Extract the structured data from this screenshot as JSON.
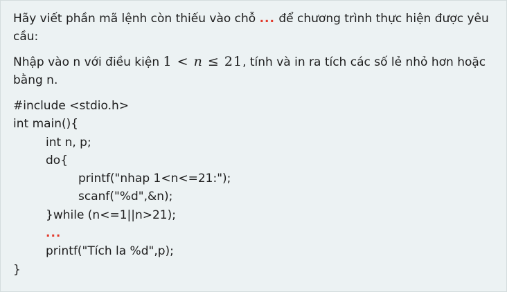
{
  "intro": {
    "before_marker": "Hãy viết phần mã lệnh còn thiếu vào chỗ ",
    "marker": "...",
    "after_marker": " để chương trình thực hiện được yêu cầu:"
  },
  "task": {
    "before_math": "Nhập vào n với điều kiện ",
    "math": {
      "lower": "1",
      "lt": "<",
      "var": "n",
      "le": "≤",
      "upper": "21"
    },
    "after_math": ", tính và in ra tích các số lẻ nhỏ hơn hoặc bằng n."
  },
  "code_lines": [
    {
      "indent": 0,
      "text": "#include <stdio.h>"
    },
    {
      "indent": 0,
      "text": "int main(){"
    },
    {
      "indent": 1,
      "text": "int n, p;"
    },
    {
      "indent": 1,
      "text": "do{"
    },
    {
      "indent": 2,
      "text": "printf(\"nhap 1<n<=21:\");"
    },
    {
      "indent": 2,
      "text": "scanf(\"%d\",&n);"
    },
    {
      "indent": 1,
      "text": "}while (n<=1||n>21);"
    },
    {
      "indent": 1,
      "text": "...",
      "highlight": true
    },
    {
      "indent": 1,
      "text": "printf(\"Tích la %d\",p);"
    },
    {
      "indent": 0,
      "text": "}"
    }
  ],
  "colors": {
    "background": "#ecf2f3",
    "text": "#1d1d1d",
    "marker": "#e23a2b"
  }
}
